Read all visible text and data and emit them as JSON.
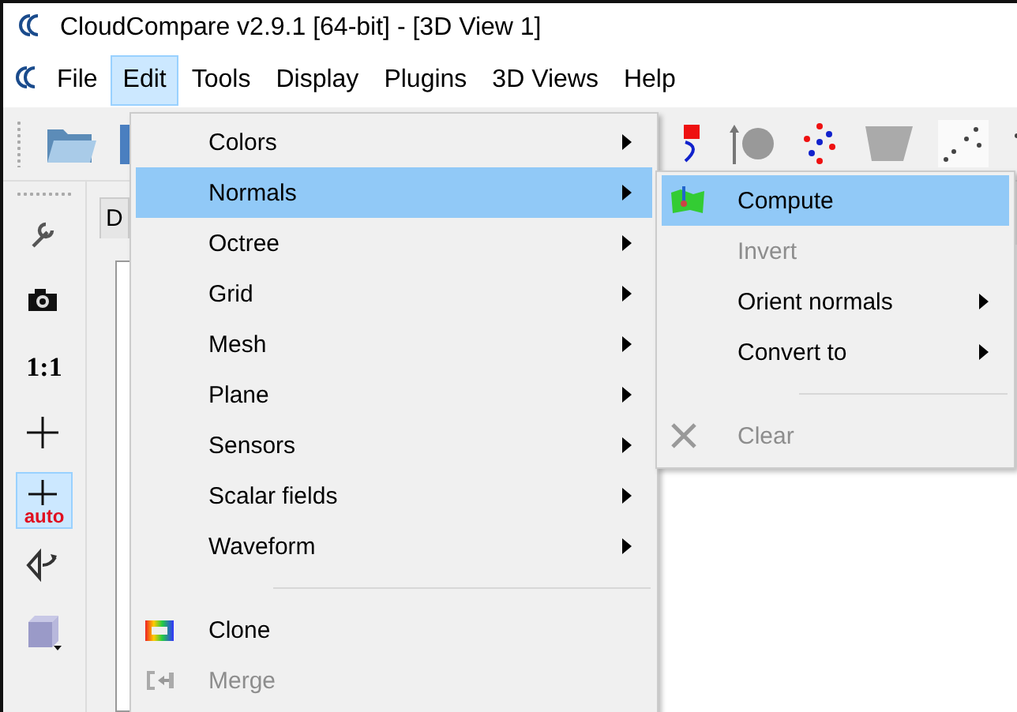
{
  "window": {
    "title": "CloudCompare v2.9.1 [64-bit] - [3D View 1]"
  },
  "menu_bar": [
    {
      "label": "File",
      "selected": false
    },
    {
      "label": "Edit",
      "selected": true
    },
    {
      "label": "Tools",
      "selected": false
    },
    {
      "label": "Display",
      "selected": false
    },
    {
      "label": "Plugins",
      "selected": false
    },
    {
      "label": "3D Views",
      "selected": false
    },
    {
      "label": "Help",
      "selected": false
    }
  ],
  "left_toolbar": [
    {
      "kind": "wrench",
      "selected": false
    },
    {
      "kind": "camera",
      "selected": false
    },
    {
      "kind": "ratio",
      "label": "1:1",
      "selected": false
    },
    {
      "kind": "cross",
      "selected": false
    },
    {
      "kind": "auto",
      "label": "auto",
      "selected": true
    },
    {
      "kind": "rotate",
      "selected": false
    },
    {
      "kind": "cube",
      "selected": false
    }
  ],
  "side_panel": {
    "tab": "D"
  },
  "edit_menu": [
    {
      "kind": "item",
      "label": "Colors",
      "submenu": true,
      "disabled": false,
      "selected": false
    },
    {
      "kind": "item",
      "label": "Normals",
      "submenu": true,
      "disabled": false,
      "selected": true
    },
    {
      "kind": "item",
      "label": "Octree",
      "submenu": true,
      "disabled": false,
      "selected": false
    },
    {
      "kind": "item",
      "label": "Grid",
      "submenu": true,
      "disabled": false,
      "selected": false
    },
    {
      "kind": "item",
      "label": "Mesh",
      "submenu": true,
      "disabled": false,
      "selected": false
    },
    {
      "kind": "item",
      "label": "Plane",
      "submenu": true,
      "disabled": false,
      "selected": false
    },
    {
      "kind": "item",
      "label": "Sensors",
      "submenu": true,
      "disabled": false,
      "selected": false
    },
    {
      "kind": "item",
      "label": "Scalar fields",
      "submenu": true,
      "disabled": false,
      "selected": false
    },
    {
      "kind": "item",
      "label": "Waveform",
      "submenu": true,
      "disabled": false,
      "selected": false
    },
    {
      "kind": "separator"
    },
    {
      "kind": "cloud",
      "label": "Clone",
      "submenu": false,
      "disabled": false,
      "selected": false
    },
    {
      "kind": "merge",
      "label": "Merge",
      "submenu": false,
      "disabled": true,
      "selected": false
    }
  ],
  "normals_submenu": [
    {
      "kind": "surface",
      "label": "Compute",
      "submenu": false,
      "disabled": false,
      "selected": true
    },
    {
      "kind": "item",
      "label": "Invert",
      "submenu": false,
      "disabled": true,
      "selected": false
    },
    {
      "kind": "item",
      "label": "Orient normals",
      "submenu": true,
      "disabled": false,
      "selected": false
    },
    {
      "kind": "item",
      "label": "Convert to",
      "submenu": true,
      "disabled": false,
      "selected": false
    },
    {
      "kind": "separator"
    },
    {
      "kind": "cross",
      "label": "Clear",
      "submenu": false,
      "disabled": true,
      "selected": false
    }
  ]
}
